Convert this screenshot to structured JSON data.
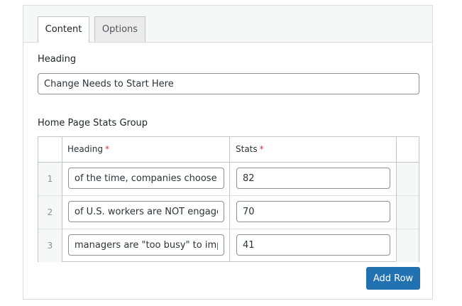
{
  "tabs": [
    {
      "label": "Content",
      "active": true
    },
    {
      "label": "Options",
      "active": false
    }
  ],
  "heading_field": {
    "label": "Heading",
    "value": "Change Needs to Start Here"
  },
  "stats_group": {
    "label": "Home Page Stats Group",
    "columns": [
      {
        "label": "Heading",
        "required_marker": "*"
      },
      {
        "label": "Stats",
        "required_marker": "*"
      }
    ],
    "rows": [
      {
        "index": "1",
        "heading": "of the time, companies choose unqualified",
        "stat": "82"
      },
      {
        "index": "2",
        "heading": "of U.S. workers are NOT engaged",
        "stat": "70"
      },
      {
        "index": "3",
        "heading": "managers are \"too busy\" to implement",
        "stat": "41"
      }
    ]
  },
  "add_row_label": "Add Row",
  "colors": {
    "primary": "#2271b1",
    "required": "#d63638",
    "border": "#c3c4c7"
  }
}
